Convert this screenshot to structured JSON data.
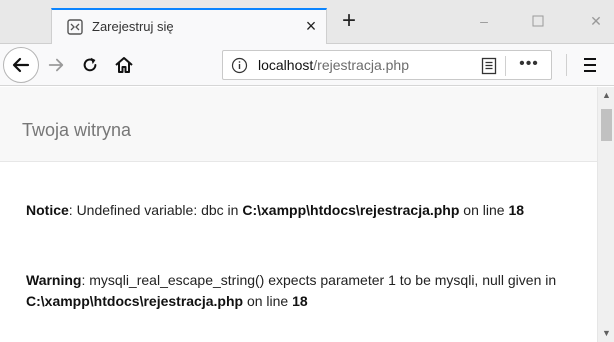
{
  "tab": {
    "title": "Zarejestruj się",
    "close_glyph": "×",
    "favicon": "page-icon"
  },
  "new_tab_glyph": "+",
  "window_controls": {
    "minimize": "–",
    "maximize": "□",
    "close": "✕"
  },
  "nav": {
    "back_glyph": "←",
    "forward_glyph": "→",
    "reload_glyph": "C",
    "home_glyph": "⌂"
  },
  "url": {
    "host": "localhost",
    "path": "/rejestracja.php",
    "more_glyph": "•••"
  },
  "site": {
    "brand": "Twoja witryna"
  },
  "messages": [
    {
      "label": "Notice",
      "text_before": ": Undefined variable: dbc in ",
      "file": "C:\\xampp\\htdocs\\rejestracja.php",
      "text_mid": " on line ",
      "line": "18"
    },
    {
      "label": "Warning",
      "text_before": ": mysqli_real_escape_string() expects parameter 1 to be mysqli, null given in ",
      "file": "C:\\xampp\\htdocs\\rejestracja.php",
      "text_mid": " on line ",
      "line": "18"
    }
  ],
  "scrollbar": {
    "up_glyph": "▲",
    "down_glyph": "▼"
  },
  "colors": {
    "accent": "#0a84ff",
    "header_bg": "#f8f8f8",
    "brand_text": "#777777"
  }
}
